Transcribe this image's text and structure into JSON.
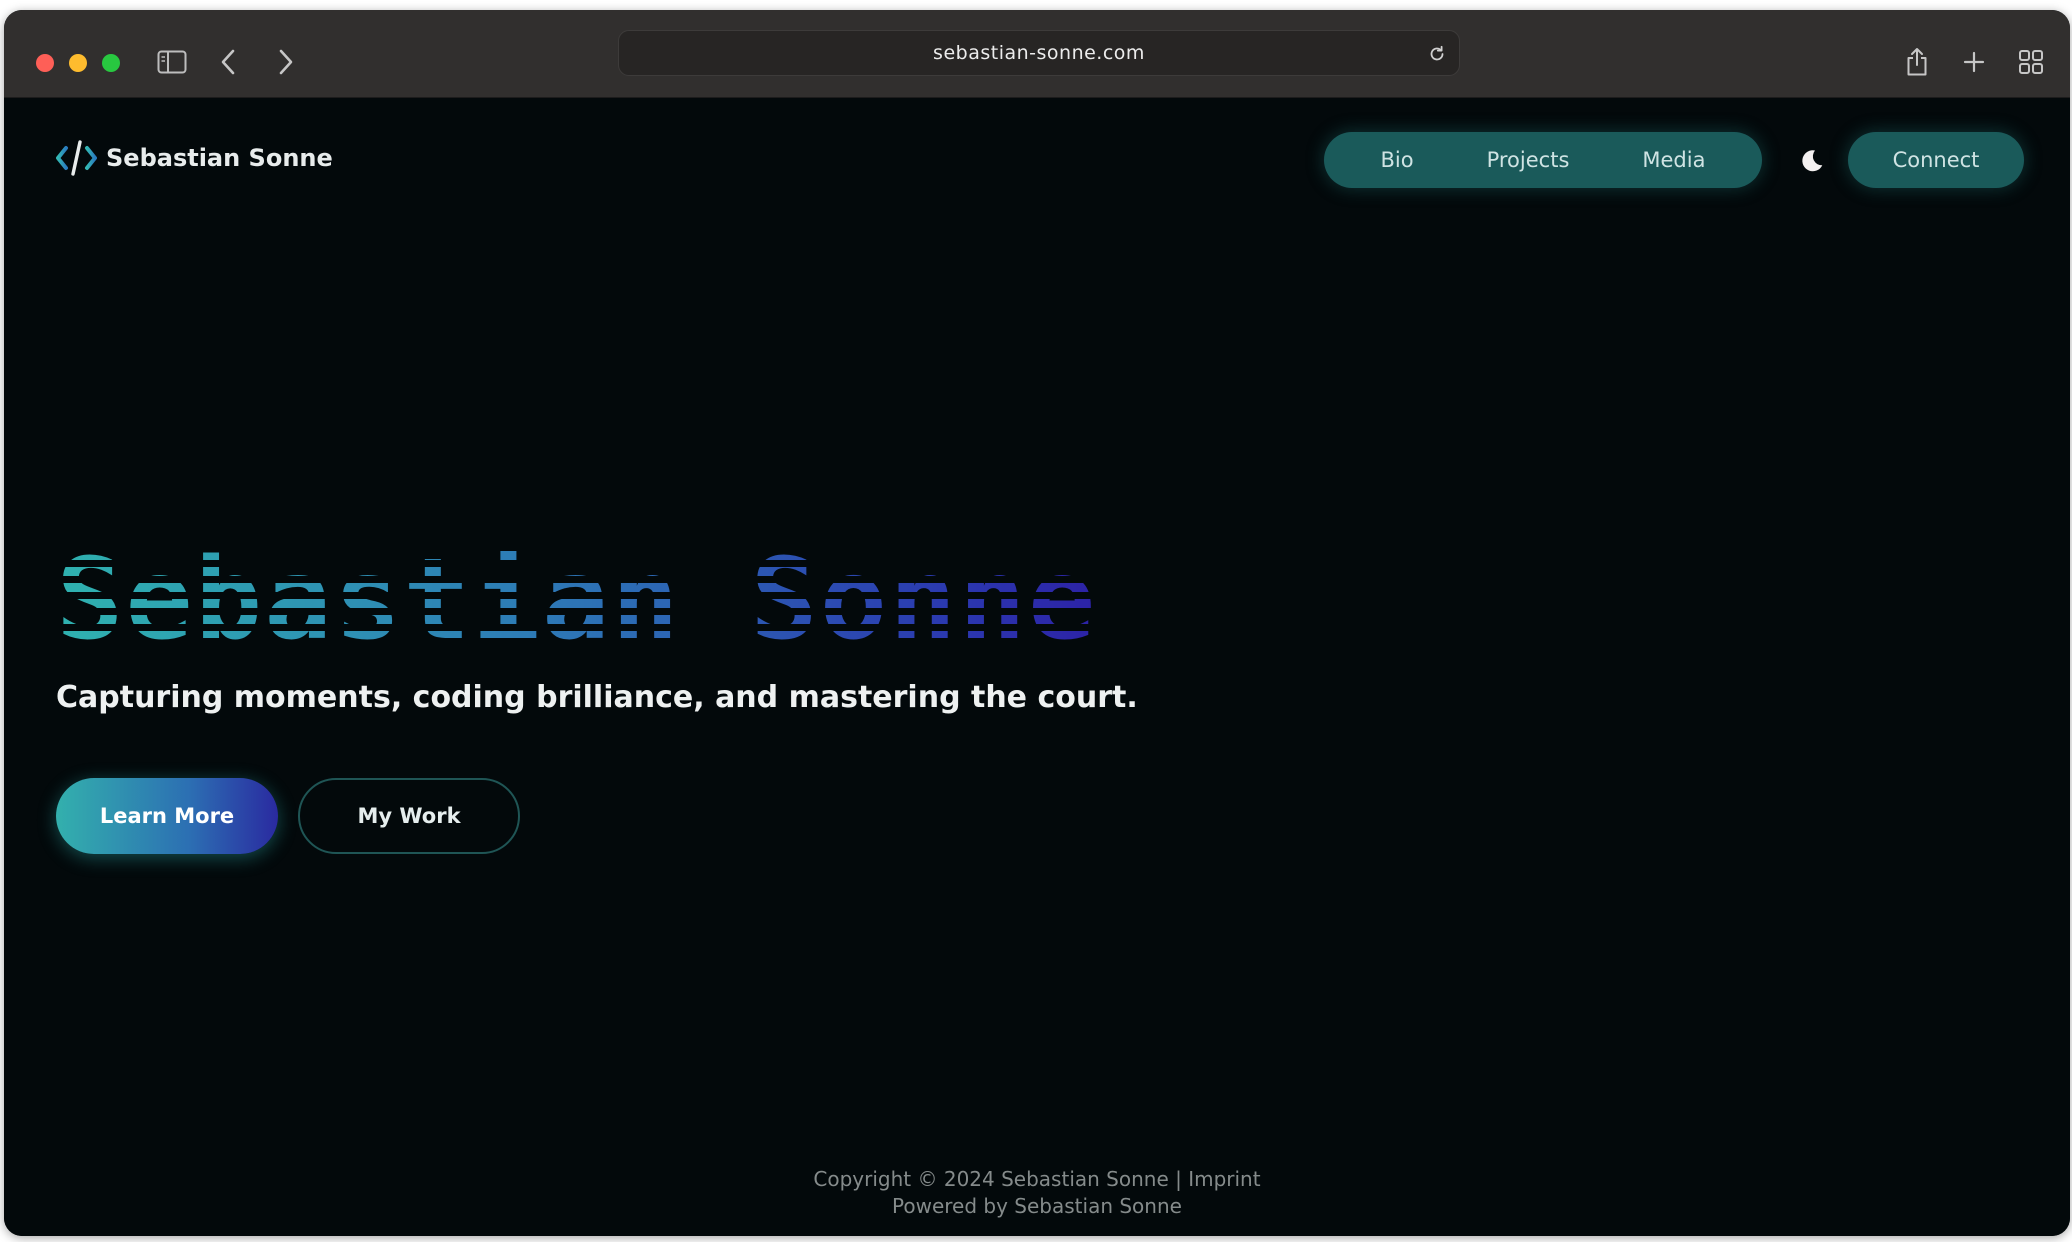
{
  "browser": {
    "url": "sebastian-sonne.com"
  },
  "site": {
    "logo_text": "Sebastian Sonne",
    "nav": [
      "Bio",
      "Projects",
      "Media"
    ],
    "connect_label": "Connect"
  },
  "hero": {
    "title": "Sebastian Sonne",
    "tagline": "Capturing moments, coding brilliance, and mastering the court.",
    "primary_button": "Learn More",
    "secondary_button": "My Work"
  },
  "footer": {
    "line1": "Copyright © 2024 Sebastian Sonne | Imprint",
    "line2": "Powered by Sebastian Sonne"
  },
  "colors": {
    "page_bg": "#03090b",
    "accent_teal": "#1a5a5a",
    "gradient_start": "#2fb2b0",
    "gradient_end": "#2c22a6"
  }
}
